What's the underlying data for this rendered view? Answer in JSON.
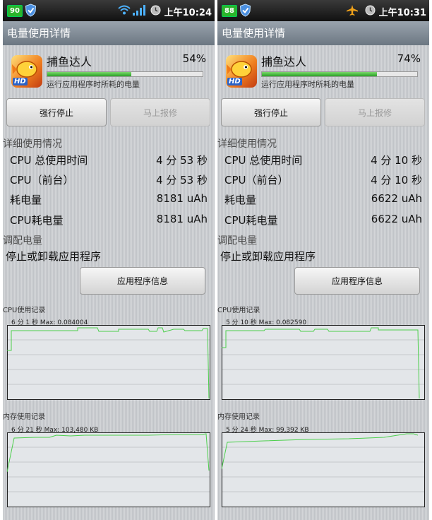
{
  "panels": [
    {
      "status": {
        "battery_label": "90",
        "time": "上午10:24",
        "icons": [
          "wifi-icon",
          "signal-icon",
          "alarm-icon"
        ]
      },
      "title": "电量使用详情",
      "app": {
        "name": "捕鱼达人",
        "percent": "54%",
        "percent_value": 54,
        "subtitle": "运行应用程序时所耗的电量",
        "icon_badge": "HD"
      },
      "buttons": {
        "force_stop": "强行停止",
        "report": "马上报修"
      },
      "details": {
        "heading": "详细使用情况",
        "rows": [
          {
            "label": "CPU 总使用时间",
            "value": "4 分 53 秒"
          },
          {
            "label": "CPU（前台）",
            "value": "4 分 53 秒"
          },
          {
            "label": "耗电量",
            "value": "8181 uAh"
          },
          {
            "label": "CPU耗电量",
            "value": "8181 uAh"
          }
        ]
      },
      "tune": {
        "heading": "调配电量",
        "uninstall_label": "停止或卸载应用程序",
        "info_button": "应用程序信息"
      },
      "cpu_graph": {
        "title": "CPU使用记录",
        "caption": "6 分 1 秒 Max: 0.084004"
      },
      "mem_graph": {
        "title": "内存使用记录",
        "caption": "6 分 21 秒 Max: 103,480 KB"
      },
      "colors": {
        "line": "#4ccf4c",
        "bar": "#29a225"
      }
    },
    {
      "status": {
        "battery_label": "88",
        "time": "上午10:31",
        "icons": [
          "airplane-icon",
          "alarm-icon"
        ]
      },
      "title": "电量使用详情",
      "app": {
        "name": "捕鱼达人",
        "percent": "74%",
        "percent_value": 74,
        "subtitle": "运行应用程序时所耗的电量",
        "icon_badge": "HD"
      },
      "buttons": {
        "force_stop": "强行停止",
        "report": "马上报修"
      },
      "details": {
        "heading": "详细使用情况",
        "rows": [
          {
            "label": "CPU 总使用时间",
            "value": "4 分 10 秒"
          },
          {
            "label": "CPU（前台）",
            "value": "4 分 10 秒"
          },
          {
            "label": "耗电量",
            "value": "6622 uAh"
          },
          {
            "label": "CPU耗电量",
            "value": "6622 uAh"
          }
        ]
      },
      "tune": {
        "heading": "调配电量",
        "uninstall_label": "停止或卸载应用程序",
        "info_button": "应用程序信息"
      },
      "cpu_graph": {
        "title": "CPU使用记录",
        "caption": "5 分 10 秒 Max: 0.082590"
      },
      "mem_graph": {
        "title": "内存使用记录",
        "caption": "5 分 24 秒 Max: 99,392 KB"
      },
      "colors": {
        "line": "#4ccf4c",
        "bar": "#29a225"
      }
    }
  ]
}
